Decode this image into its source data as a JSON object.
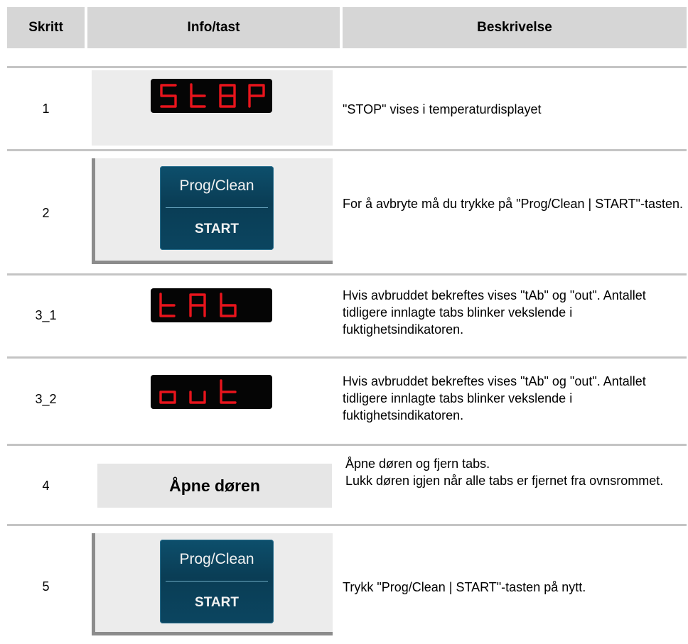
{
  "header": {
    "col_step": "Skritt",
    "col_info": "Info/tast",
    "col_desc": "Beskrivelse"
  },
  "rows": [
    {
      "step": "1",
      "display": "StOP",
      "description": "\"STOP\" vises i temperaturdisplayet"
    },
    {
      "step": "2",
      "key_top": "Prog/Clean",
      "key_bottom": "START",
      "description": "For å avbryte må du trykke på \"Prog/Clean | START\"-tasten."
    },
    {
      "step": "3_1",
      "display": "tAb",
      "description": "Hvis avbruddet bekreftes vises \"tAb\" og \"out\". Antallet tidligere innlagte tabs blinker vekslende i fuktighetsindikatoren."
    },
    {
      "step": "3_2",
      "display": "out",
      "description": "Hvis avbruddet bekreftes vises \"tAb\" og \"out\". Antallet tidligere innlagte tabs blinker vekslende i fuktighetsindikatoren."
    },
    {
      "step": "4",
      "info_text": "Åpne døren",
      "description_1": "Åpne døren og fjern tabs.",
      "description_2": "Lukk døren igjen når alle tabs er fjernet fra ovnsrommet."
    },
    {
      "step": "5",
      "key_top": "Prog/Clean",
      "key_bottom": "START",
      "description": "Trykk \"Prog/Clean | START\"-tasten på nytt."
    }
  ],
  "colors": {
    "header_bg": "#d6d6d6",
    "segment_red": "#e8141c",
    "key_blue": "#0b4560"
  }
}
